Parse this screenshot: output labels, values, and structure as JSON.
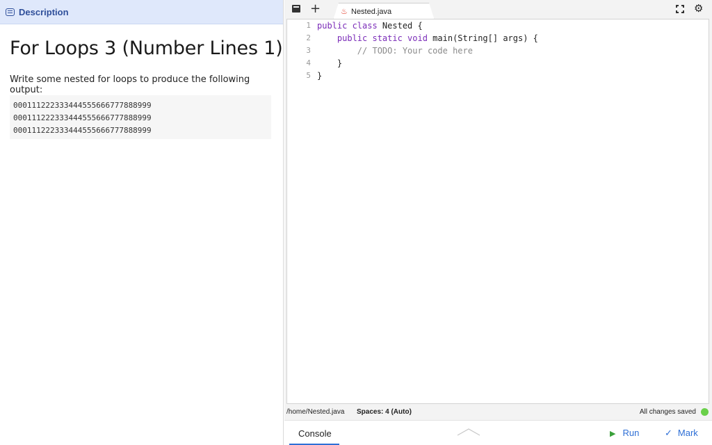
{
  "description_tab": {
    "label": "Description",
    "icon": "description-icon"
  },
  "problem": {
    "title": "For Loops 3 (Number Lines 1)",
    "prompt": "Write some nested for loops to produce the following output:",
    "output_lines": [
      "000111222333444555666777888999",
      "000111222333444555666777888999",
      "000111222333444555666777888999"
    ]
  },
  "editor_tabs": {
    "file_name": "Nested.java",
    "file_icon": "java-icon",
    "add_icon": "plus-icon",
    "folder_icon": "folder-icon",
    "fullscreen_icon": "fullscreen-icon",
    "settings_icon": "gear-icon"
  },
  "code": {
    "line_numbers": [
      "1",
      "2",
      "3",
      "4",
      "5"
    ],
    "lines": [
      {
        "kw": "public class",
        "rest": " Nested {"
      },
      {
        "indent": "    ",
        "kw": "public static void",
        "rest": " main(String[] args) {"
      },
      {
        "indent": "        ",
        "comment": "// TODO: Your code here"
      },
      {
        "indent": "    ",
        "rest": "}"
      },
      {
        "rest": "}"
      }
    ]
  },
  "status": {
    "path": "/home/Nested.java",
    "spaces": "Spaces: 4 (Auto)",
    "saved": "All changes saved",
    "saved_color": "#6ad04a"
  },
  "bottom": {
    "console_label": "Console",
    "run_label": "Run",
    "mark_label": "Mark",
    "accent": "#2e6fd6"
  }
}
